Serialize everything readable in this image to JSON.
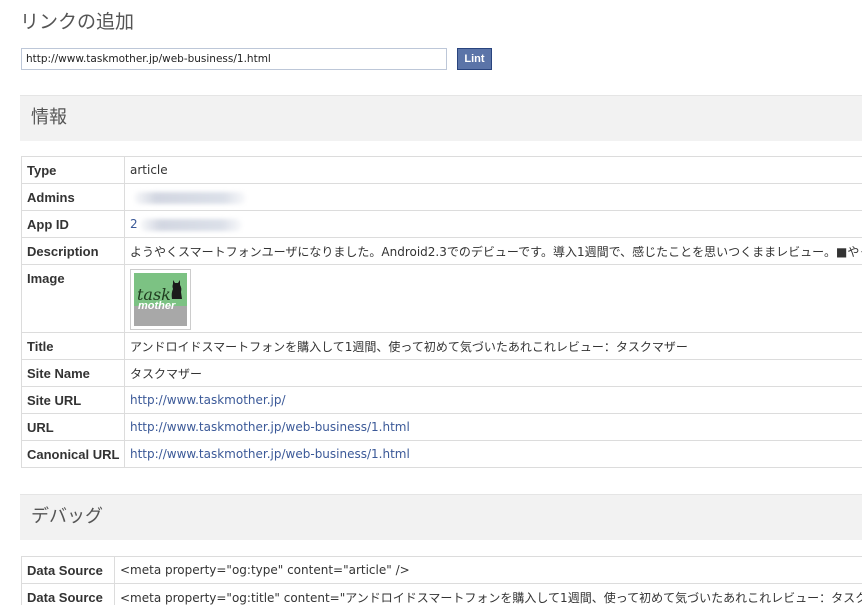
{
  "page": {
    "title": "リンクの追加"
  },
  "url_form": {
    "value": "http://www.taskmother.jp/web-business/1.html",
    "lint_label": "Lint"
  },
  "colors": {
    "link": "#3b5998",
    "button": "#5b74a8",
    "section_bg": "#f2f2f2"
  },
  "info": {
    "header": "情報",
    "rows": {
      "type": {
        "key": "Type",
        "value": "article"
      },
      "admins": {
        "key": "Admins",
        "value": ""
      },
      "app_id": {
        "key": "App ID",
        "value": "2"
      },
      "description": {
        "key": "Description",
        "value": "ようやくスマートフォンユーザになりました。Android2.3でのデビューです。導入1週間で、感じたことを思いつくままレビュー。■やっぱり電話機じゃ"
      },
      "image": {
        "key": "Image",
        "thumb_text_1": "task",
        "thumb_text_2": "mother",
        "icon": "cat-silhouette-icon"
      },
      "title": {
        "key": "Title",
        "value": "アンドロイドスマートフォンを購入して1週間、使って初めて気づいたあれこれレビュー：タスクマザー"
      },
      "site_name": {
        "key": "Site Name",
        "value": "タスクマザー"
      },
      "site_url": {
        "key": "Site URL",
        "value": "http://www.taskmother.jp/"
      },
      "url": {
        "key": "URL",
        "value": "http://www.taskmother.jp/web-business/1.html"
      },
      "canonical_url": {
        "key": "Canonical URL",
        "value": "http://www.taskmother.jp/web-business/1.html"
      }
    }
  },
  "debug": {
    "header": "デバッグ",
    "rows": [
      {
        "key": "Data Source",
        "value": "<meta property=\"og:type\" content=\"article\" />"
      },
      {
        "key": "Data Source",
        "value": "<meta property=\"og:title\" content=\"アンドロイドスマートフォンを購入して1週間、使って初めて気づいたあれこれレビュー：タスクマザー\" />"
      }
    ]
  }
}
